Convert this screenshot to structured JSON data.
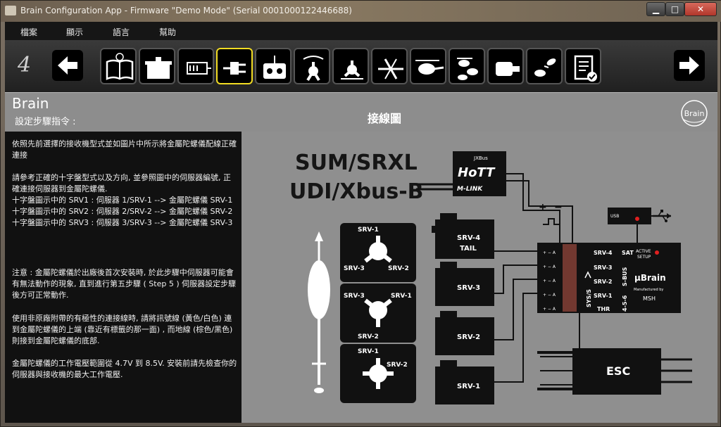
{
  "window": {
    "title": "Brain Configuration App - Firmware \"Demo Mode\" (Serial 0001000122446688)",
    "min_glyph": "▁",
    "max_glyph": "□",
    "close_glyph": "✕"
  },
  "menu": [
    "檔案",
    "顯示",
    "語言",
    "幫助"
  ],
  "toolbar": {
    "step": "4",
    "back_glyph": "🡐",
    "next_glyph": "🡒",
    "tools": [
      {
        "icon": "manual-book-icon"
      },
      {
        "icon": "unit-box-icon"
      },
      {
        "icon": "receiver-icon"
      },
      {
        "icon": "plug-connector-icon",
        "active": true
      },
      {
        "icon": "transmitter-icon"
      },
      {
        "icon": "swashplate-type-icon"
      },
      {
        "icon": "swashplate-icon"
      },
      {
        "icon": "tail-rotor-icon"
      },
      {
        "icon": "helicopter-side-icon"
      },
      {
        "icon": "helicopter-multi-icon"
      },
      {
        "icon": "motor-icon"
      },
      {
        "icon": "flight-modes-icon"
      },
      {
        "icon": "checklist-icon"
      }
    ]
  },
  "header": {
    "brand": "Brain",
    "subtitle": "設定步驟指令 :",
    "title": "接線圖",
    "logo": "Brain"
  },
  "instructions": {
    "p1": "依照先前選擇的接收機型式並如圖片中所示將金屬陀螺儀配線正確連接",
    "p2": "請參考正確的十字盤型式以及方向, 並參照圖中的伺服器編號, 正確連接伺服器到金屬陀螺儀.\n十字盤圖示中的 SRV1 : 伺服器 1/SRV-1 --> 金屬陀螺儀 SRV-1\n十字盤圖示中的 SRV2 : 伺服器 2/SRV-2 --> 金屬陀螺儀 SRV-2\n十字盤圖示中的 SRV3 : 伺服器 3/SRV-3 --> 金屬陀螺儀 SRV-3",
    "p3": "注意 : 金屬陀螺儀於出廠後首次安裝時, 於此步驟中伺服器可能會有無法動作的現象, 直到進行第五步驟 ( Step 5 ) 伺服器設定步驟後方可正常動作.",
    "p4": "使用非原廠附帶的有極性的連接線時, 請將訊號線 (黃色/白色) 連到金屬陀螺儀的上端 (靠近有標籤的那一面) , 而地線 (棕色/黑色) 則接到金屬陀螺儀的底部.",
    "p5": "金屬陀螺儀的工作電壓範圍從 4.7V 到 8.5V. 安裝前請先檢查你的伺服器與接收機的最大工作電壓."
  },
  "diagram": {
    "label_line1": "SUM/SRXL",
    "label_line2": "UDI/Xbus-B",
    "receiver_brand": "JXBus",
    "receiver_name": "HoTT",
    "receiver_sub": "M-LINK",
    "polarity_plus": "+",
    "polarity_minus": "−",
    "swash1": {
      "top": "SRV-1",
      "left": "SRV-3",
      "right": "SRV-2"
    },
    "swash2": {
      "left": "SRV-3",
      "right": "SRV-1",
      "bottom": "SRV-2"
    },
    "swash3": {
      "top": "SRV-1",
      "right": "SRV-2"
    },
    "servo_tail": "SRV-4",
    "servo_tail_sub": "TAIL",
    "servo3": "SRV-3",
    "servo2": "SRV-2",
    "servo1": "SRV-1",
    "unit_ports": [
      "SRV-4",
      "SRV-3",
      "SRV-2",
      "SRV-1",
      "THR"
    ],
    "unit_side": [
      "SAT",
      "S-BUS",
      "4-5-6"
    ],
    "unit_sys": "SYS/S",
    "unit_active": "ACTIVE",
    "unit_setup": "SETUP",
    "unit_brand": "μBrain",
    "unit_made": "Manufactured by",
    "unit_maker": "MSH",
    "usb_label": "USB",
    "esc": "ESC"
  }
}
